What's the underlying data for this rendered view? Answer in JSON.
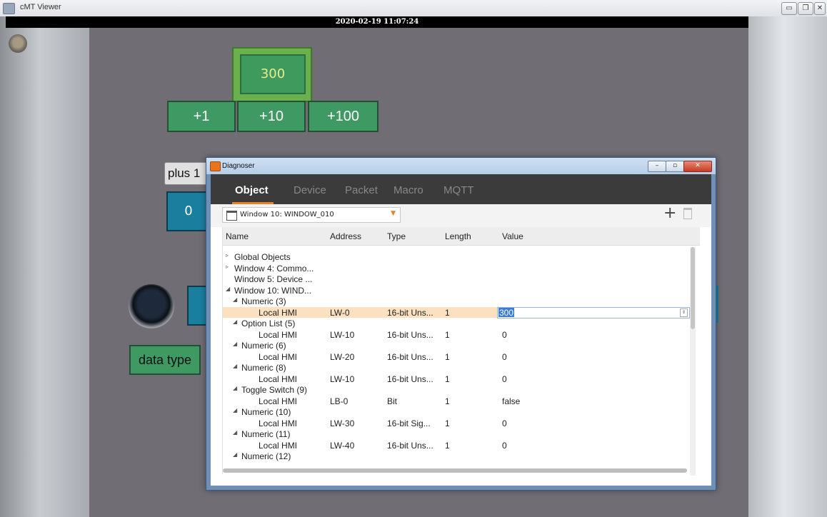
{
  "app": {
    "title": "cMT Viewer",
    "datetime": "2020-02-19 11:07:24"
  },
  "window_controls": {
    "minimize": "▭",
    "restore": "❐",
    "close": "✕"
  },
  "hmi": {
    "numeric_value": "300",
    "buttons": [
      "+1",
      "+10",
      "+100"
    ],
    "plus_label": "plus 1",
    "zero_value": "0",
    "data_type_label": "data type"
  },
  "diagnoser": {
    "title": "Diagnoser",
    "controls": {
      "minimize": "–",
      "maximize": "▫",
      "close": "✕"
    },
    "tabs": [
      "Object",
      "Device",
      "Packet",
      "Macro",
      "MQTT"
    ],
    "active_tab": "Object",
    "window_select": "Window 10: WINDOW_010",
    "add_label": "+",
    "columns": [
      "Name",
      "Address",
      "Type",
      "Length",
      "Value"
    ],
    "rows": [
      {
        "tree": "▹",
        "indent": 0,
        "name": "Global Objects",
        "address": "",
        "type": "",
        "length": "",
        "value": ""
      },
      {
        "tree": "▹",
        "indent": 0,
        "name": "Window 4: Commo...",
        "address": "",
        "type": "",
        "length": "",
        "value": ""
      },
      {
        "tree": "",
        "indent": 0,
        "name": "Window 5: Device ...",
        "address": "",
        "type": "",
        "length": "",
        "value": ""
      },
      {
        "tree": "◢",
        "indent": 0,
        "name": "Window 10: WIND...",
        "address": "",
        "type": "",
        "length": "",
        "value": ""
      },
      {
        "tree": "◢",
        "indent": 1,
        "name": "Numeric (3)",
        "address": "",
        "type": "",
        "length": "",
        "value": ""
      },
      {
        "tree": "",
        "indent": 2,
        "name": "Local HMI",
        "address": "LW-0",
        "type": "16-bit Uns...",
        "length": "1",
        "value": "300",
        "selected": true
      },
      {
        "tree": "◢",
        "indent": 1,
        "name": "Option List (5)",
        "address": "",
        "type": "",
        "length": "",
        "value": ""
      },
      {
        "tree": "",
        "indent": 2,
        "name": "Local HMI",
        "address": "LW-10",
        "type": "16-bit Uns...",
        "length": "1",
        "value": "0"
      },
      {
        "tree": "◢",
        "indent": 1,
        "name": "Numeric (6)",
        "address": "",
        "type": "",
        "length": "",
        "value": ""
      },
      {
        "tree": "",
        "indent": 2,
        "name": "Local HMI",
        "address": "LW-20",
        "type": "16-bit Uns...",
        "length": "1",
        "value": "0"
      },
      {
        "tree": "◢",
        "indent": 1,
        "name": "Numeric (8)",
        "address": "",
        "type": "",
        "length": "",
        "value": ""
      },
      {
        "tree": "",
        "indent": 2,
        "name": "Local HMI",
        "address": "LW-10",
        "type": "16-bit Uns...",
        "length": "1",
        "value": "0"
      },
      {
        "tree": "◢",
        "indent": 1,
        "name": "Toggle Switch (9)",
        "address": "",
        "type": "",
        "length": "",
        "value": ""
      },
      {
        "tree": "",
        "indent": 2,
        "name": "Local HMI",
        "address": "LB-0",
        "type": "Bit",
        "length": "1",
        "value": "false"
      },
      {
        "tree": "◢",
        "indent": 1,
        "name": "Numeric (10)",
        "address": "",
        "type": "",
        "length": "",
        "value": ""
      },
      {
        "tree": "",
        "indent": 2,
        "name": "Local HMI",
        "address": "LW-30",
        "type": "16-bit Sig...",
        "length": "1",
        "value": "0"
      },
      {
        "tree": "◢",
        "indent": 1,
        "name": "Numeric (11)",
        "address": "",
        "type": "",
        "length": "",
        "value": ""
      },
      {
        "tree": "",
        "indent": 2,
        "name": "Local HMI",
        "address": "LW-40",
        "type": "16-bit Uns...",
        "length": "1",
        "value": "0"
      },
      {
        "tree": "◢",
        "indent": 1,
        "name": "Numeric (12)",
        "address": "",
        "type": "",
        "length": "",
        "value": ""
      }
    ]
  }
}
